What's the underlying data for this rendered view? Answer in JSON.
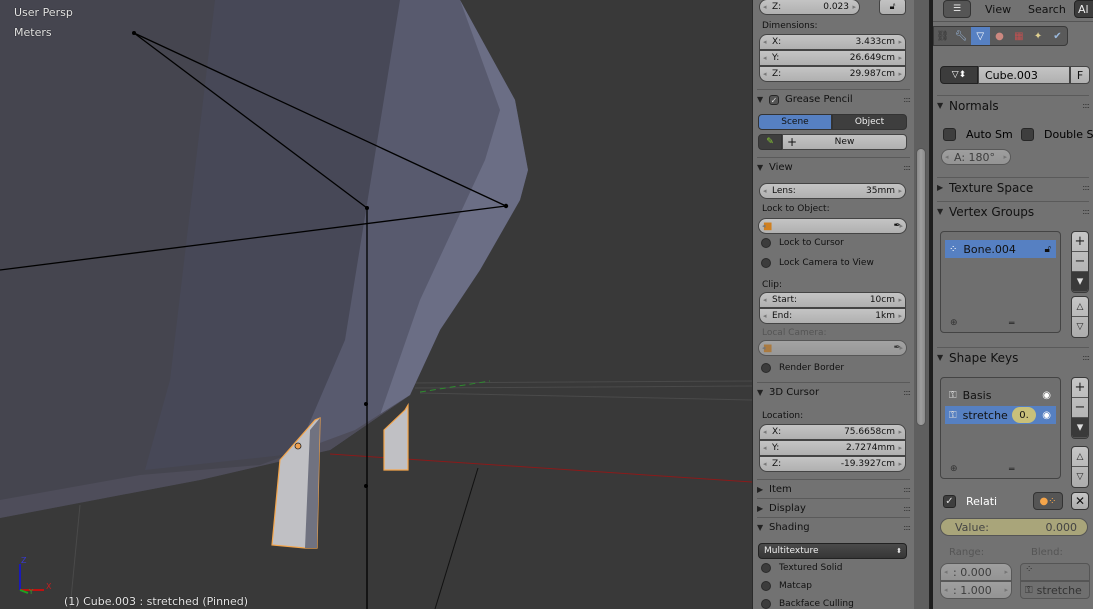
{
  "viewport": {
    "view_name": "User Persp",
    "units": "Meters",
    "status": "(1) Cube.003 : stretched (Pinned)",
    "axis_labels": {
      "x": "X",
      "y": "Y",
      "z": "Z"
    },
    "colors": {
      "mesh": "#6b6e85",
      "mesh_dark": "#45454f",
      "selected_outline": "#f5a54a",
      "x_axis": "#8b1a1a",
      "y_axis": "#2e8b2e"
    }
  },
  "npanel": {
    "rotation_z": {
      "label": "Z:",
      "value": "0.023"
    },
    "dimensions": {
      "label": "Dimensions:",
      "x": {
        "label": "X:",
        "value": "3.433cm"
      },
      "y": {
        "label": "Y:",
        "value": "26.649cm"
      },
      "z": {
        "label": "Z:",
        "value": "29.987cm"
      }
    },
    "grease_pencil": {
      "title": "Grease Pencil",
      "enabled": true,
      "tabs": [
        {
          "label": "Scene",
          "active": true
        },
        {
          "label": "Object",
          "active": false
        }
      ],
      "new_label": "New"
    },
    "view": {
      "title": "View",
      "lens": {
        "label": "Lens:",
        "value": "35mm"
      },
      "lock_to_object_label": "Lock to Object:",
      "lock_to_cursor": "Lock to Cursor",
      "lock_camera_to_view": "Lock Camera to View",
      "clip_label": "Clip:",
      "clip_start": {
        "label": "Start:",
        "value": "10cm"
      },
      "clip_end": {
        "label": "End:",
        "value": "1km"
      },
      "local_camera_label": "Local Camera:",
      "render_border": "Render Border"
    },
    "cursor": {
      "title": "3D Cursor",
      "location_label": "Location:",
      "x": {
        "label": "X:",
        "value": "75.6658cm"
      },
      "y": {
        "label": "Y:",
        "value": "2.7274mm"
      },
      "z": {
        "label": "Z:",
        "value": "-19.3927cm"
      }
    },
    "collapsed": [
      "Item",
      "Display"
    ],
    "shading": {
      "title": "Shading",
      "mode": "Multitexture",
      "options": [
        "Textured Solid",
        "Matcap",
        "Backface Culling"
      ]
    }
  },
  "properties": {
    "header": {
      "menus": [
        "View",
        "Search"
      ],
      "filter": "Al"
    },
    "mesh_name": "Cube.003",
    "fake_user": "F",
    "normals": {
      "title": "Normals",
      "auto_smooth": "Auto Sm",
      "double_sided": "Double S",
      "angle": "A: 180°"
    },
    "texture_space": {
      "title": "Texture Space"
    },
    "vertex_groups": {
      "title": "Vertex Groups",
      "items": [
        {
          "name": "Bone.004",
          "selected": true
        }
      ]
    },
    "shape_keys": {
      "title": "Shape Keys",
      "items": [
        {
          "name": "Basis",
          "selected": false,
          "value": ""
        },
        {
          "name": "stretche",
          "selected": true,
          "value": "0."
        }
      ],
      "relative": {
        "label": "Relati",
        "checked": true
      },
      "value": {
        "label": "Value:",
        "value": "0.000"
      },
      "range_label": "Range:",
      "range_min": ": 0.000",
      "range_max": ": 1.000",
      "blend_label": "Blend:",
      "blend_shape": "stretche"
    }
  }
}
